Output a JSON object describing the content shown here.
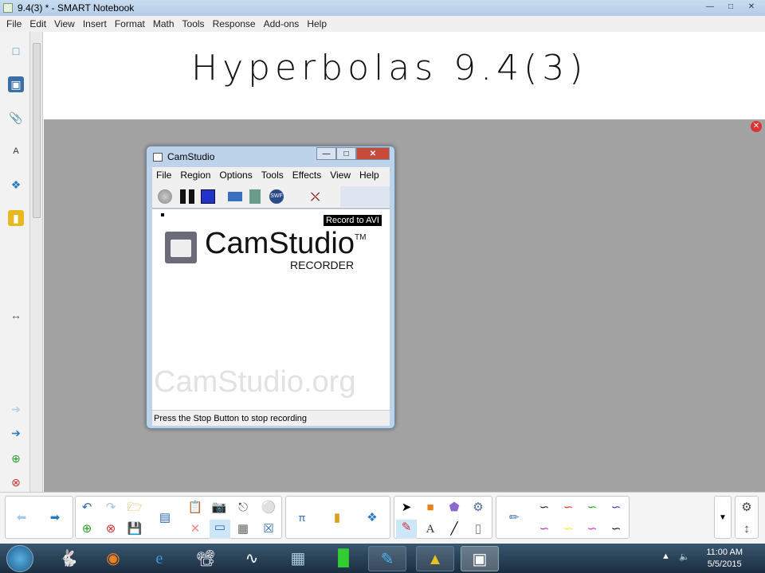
{
  "window": {
    "title": "9.4(3) * - SMART Notebook"
  },
  "menu": [
    "File",
    "Edit",
    "View",
    "Insert",
    "Format",
    "Math",
    "Tools",
    "Response",
    "Add-ons",
    "Help"
  ],
  "page": {
    "heading": "Hyperbolas 9.4(3)"
  },
  "camstudio": {
    "title": "CamStudio",
    "menu": [
      "File",
      "Region",
      "Options",
      "Tools",
      "Effects",
      "View",
      "Help"
    ],
    "record_mode": "Record to AVI",
    "brand": "CamStudio",
    "tm": "TM",
    "subtitle": "RECORDER",
    "watermark": "CamStudio.org",
    "status": "Press the Stop Button to stop recording"
  },
  "clock": {
    "time": "11:00 AM",
    "date": "5/5/2015"
  }
}
